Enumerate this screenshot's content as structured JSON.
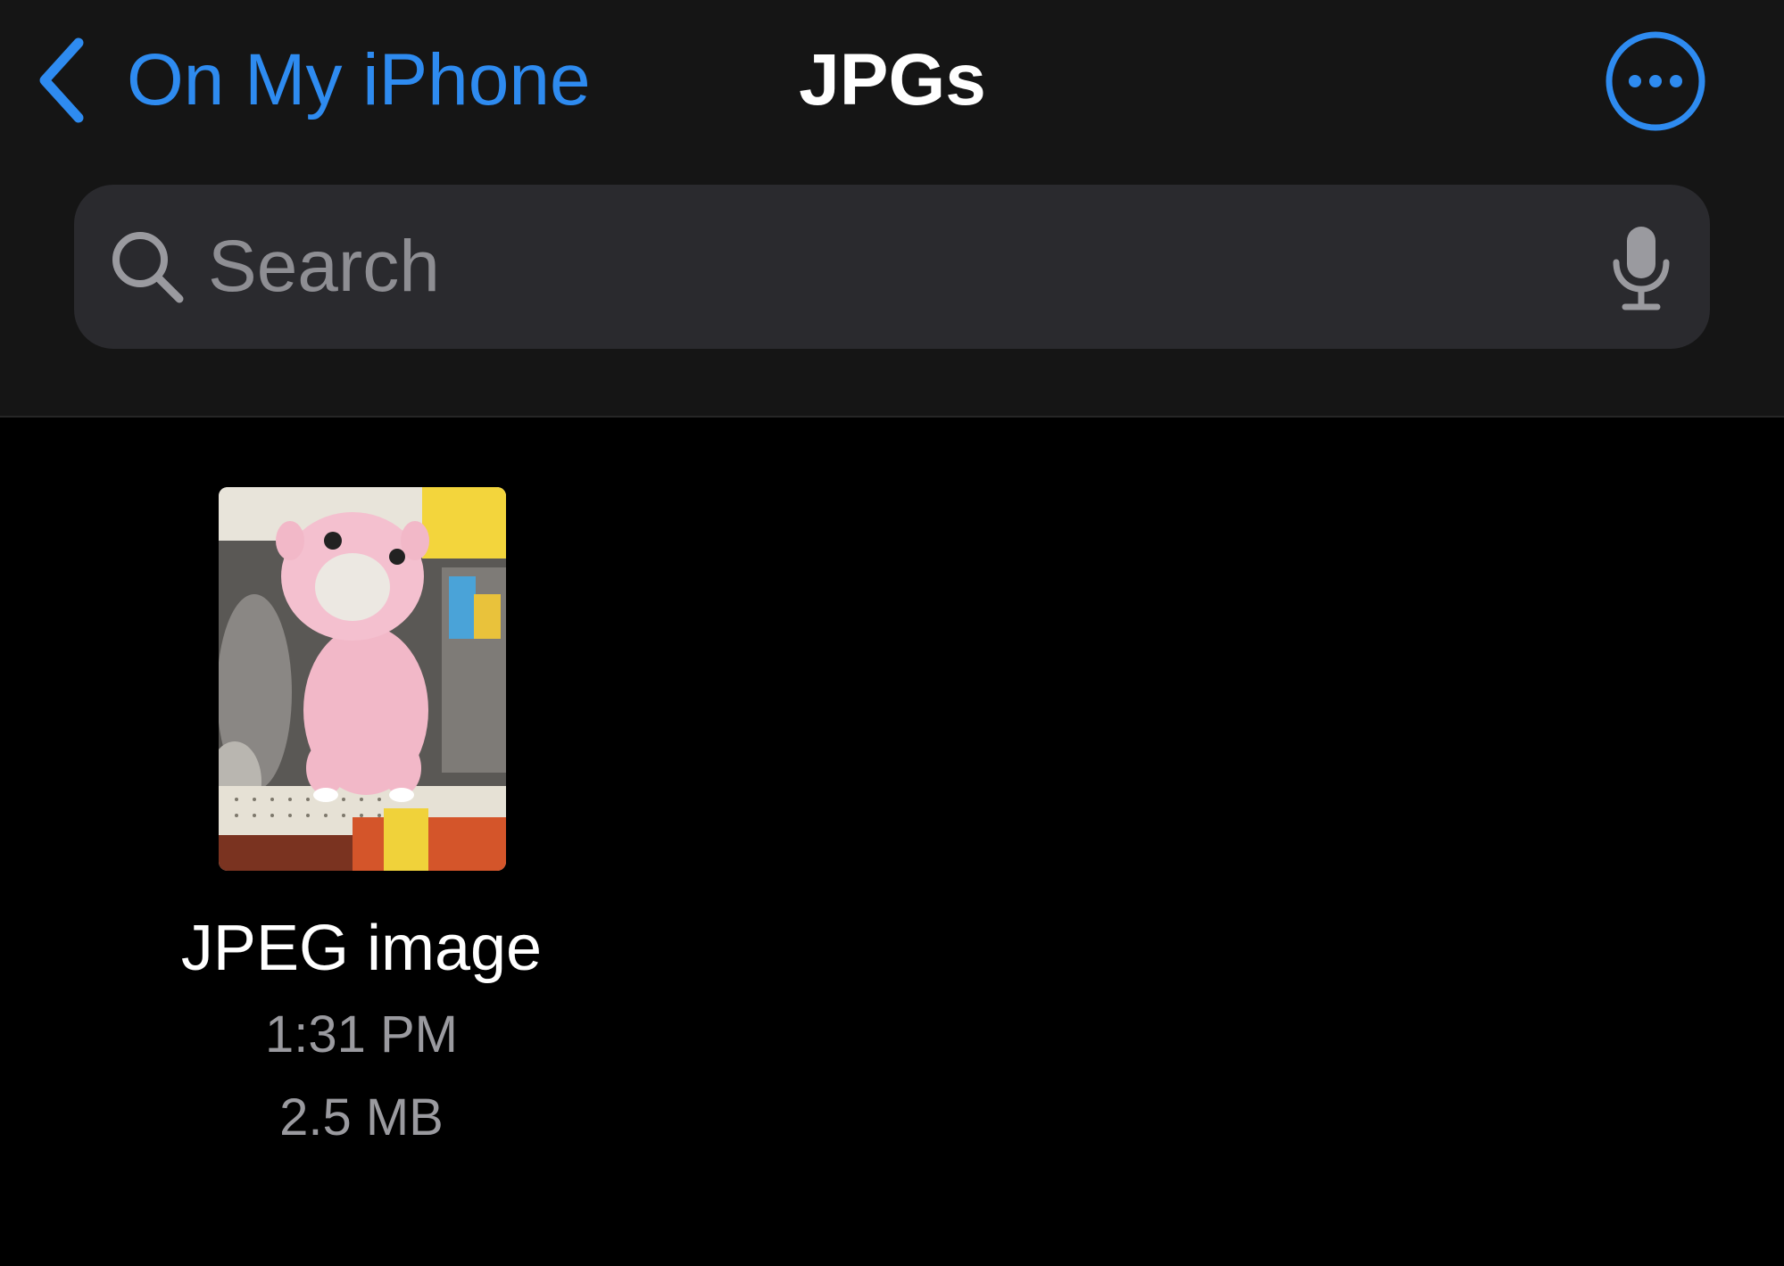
{
  "nav": {
    "back_label": "On My iPhone",
    "title": "JPGs",
    "back_icon": "chevron-left-icon",
    "more_icon": "ellipsis-circle-icon"
  },
  "search": {
    "placeholder": "Search",
    "value": "",
    "search_icon": "magnifying-glass-icon",
    "mic_icon": "microphone-icon"
  },
  "files": [
    {
      "name": "JPEG image",
      "time": "1:31 PM",
      "size": "2.5 MB",
      "thumbnail_icon": "photo-thumbnail"
    }
  ],
  "colors": {
    "accent": "#2E8BF0",
    "header_bg": "#151515",
    "content_bg": "#000000",
    "search_bg": "#2a2a2e",
    "secondary_text": "#9a9a9f"
  }
}
